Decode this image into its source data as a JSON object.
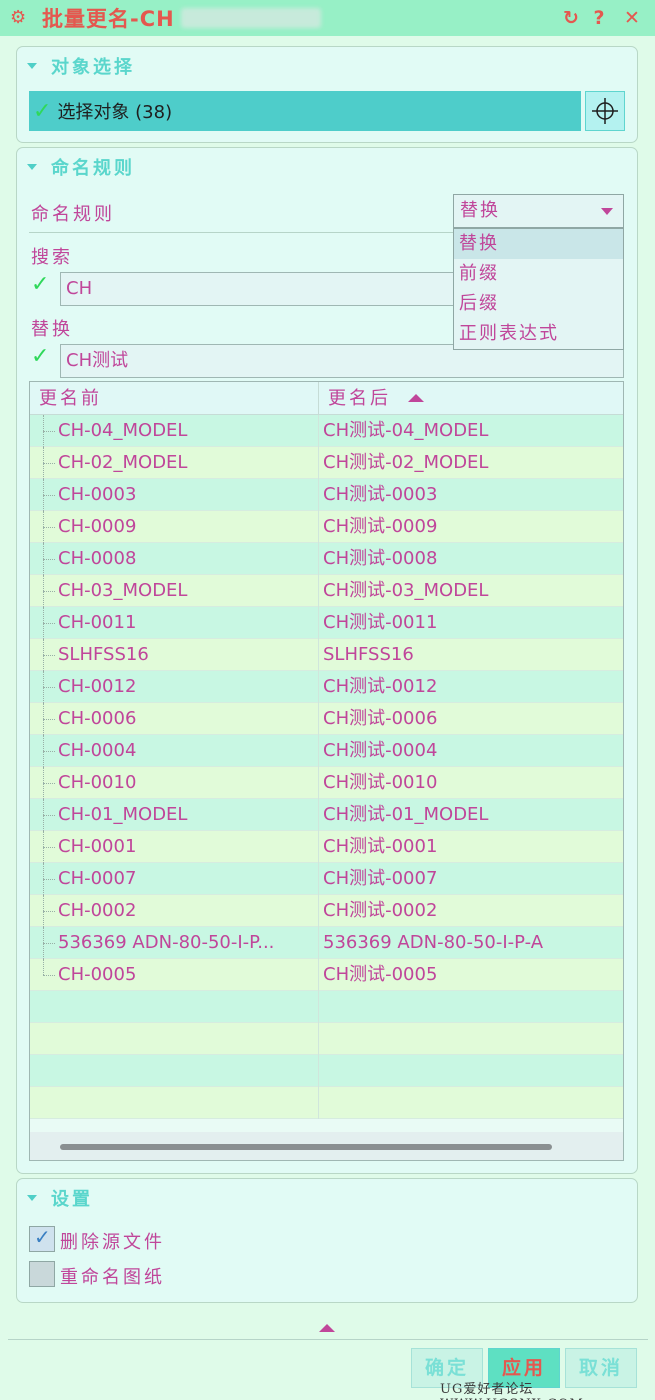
{
  "window": {
    "title": "批量更名-CH",
    "icon": "gear-icon",
    "buttons": [
      "reset-icon",
      "help-icon",
      "close-icon"
    ],
    "reset_glyph": "↻",
    "help_glyph": "?",
    "close_glyph": "✕"
  },
  "object_select": {
    "title": "对象选择",
    "select_label": "选择对象 (38)"
  },
  "naming": {
    "title": "命名规则",
    "rule_label": "命名规则",
    "rule_value": "替换",
    "rule_options": [
      "替换",
      "前缀",
      "后缀",
      "正则表达式"
    ],
    "search_label": "搜索",
    "search_value": "CH",
    "replace_label": "替换",
    "replace_value": "CH测试"
  },
  "table": {
    "columns": [
      "更名前",
      "更名后"
    ],
    "rows": [
      [
        "CH-04_MODEL",
        "CH测试-04_MODEL"
      ],
      [
        "CH-02_MODEL",
        "CH测试-02_MODEL"
      ],
      [
        "CH-0003",
        "CH测试-0003"
      ],
      [
        "CH-0009",
        "CH测试-0009"
      ],
      [
        "CH-0008",
        "CH测试-0008"
      ],
      [
        "CH-03_MODEL",
        "CH测试-03_MODEL"
      ],
      [
        "CH-0011",
        "CH测试-0011"
      ],
      [
        "SLHFSS16",
        "SLHFSS16"
      ],
      [
        "CH-0012",
        "CH测试-0012"
      ],
      [
        "CH-0006",
        "CH测试-0006"
      ],
      [
        "CH-0004",
        "CH测试-0004"
      ],
      [
        "CH-0010",
        "CH测试-0010"
      ],
      [
        "CH-01_MODEL",
        "CH测试-01_MODEL"
      ],
      [
        "CH-0001",
        "CH测试-0001"
      ],
      [
        "CH-0007",
        "CH测试-0007"
      ],
      [
        "CH-0002",
        "CH测试-0002"
      ],
      [
        "536369 ADN-80-50-I-P...",
        "536369 ADN-80-50-I-P-A"
      ],
      [
        "CH-0005",
        "CH测试-0005"
      ]
    ],
    "empty_rows": 4
  },
  "settings": {
    "title": "设置",
    "delete_source_label": "删除源文件",
    "delete_source_checked": true,
    "rename_drawing_label": "重命名图纸",
    "rename_drawing_checked": false
  },
  "buttons": {
    "ok": "确定",
    "apply": "应用",
    "cancel": "取消"
  },
  "watermark": "UG爱好者论坛 WWW.UGSNX.COM",
  "colors": {
    "accent": "#4ecdca",
    "text": "#c0469a",
    "title": "#e4584f",
    "check": "#2fd85a"
  }
}
